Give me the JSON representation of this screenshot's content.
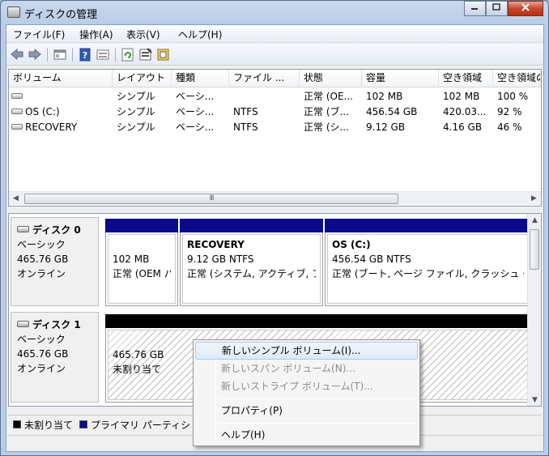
{
  "window": {
    "title": "ディスクの管理",
    "controls": [
      "minimize",
      "maximize",
      "close"
    ]
  },
  "menu": [
    "ファイル(F)",
    "操作(A)",
    "表示(V)",
    "ヘルプ(H)"
  ],
  "toolbar": [
    "back-icon",
    "forward-icon",
    "console-icon",
    "help-icon",
    "view-icon",
    "refresh-icon",
    "properties-icon",
    "rescan-icon"
  ],
  "list": {
    "columns": [
      "ボリューム",
      "レイアウト",
      "種類",
      "ファイル ...",
      "状態",
      "容量",
      "空き領域",
      "空き領域の"
    ],
    "rows": [
      [
        "",
        "シンプル",
        "ベーシ...",
        "",
        "正常 (OE...",
        "102 MB",
        "102 MB",
        "100 %"
      ],
      [
        "OS (C:)",
        "シンプル",
        "ベーシ...",
        "NTFS",
        "正常 (ブ...",
        "456.54 GB",
        "420.03...",
        "92 %"
      ],
      [
        "RECOVERY",
        "シンプル",
        "ベーシ...",
        "NTFS",
        "正常 (シ...",
        "9.12 GB",
        "4.16 GB",
        "46 %"
      ]
    ]
  },
  "scroll_thumb_grip": "III",
  "disks": [
    {
      "name": "ディスク 0",
      "type": "ベーシック",
      "size": "465.76 GB",
      "status": "オンライン",
      "partitions": [
        {
          "name": "",
          "size": "102 MB",
          "desc": "正常 (OEM パ"
        },
        {
          "name": "RECOVERY",
          "size": "9.12 GB NTFS",
          "desc": "正常 (システム, アクティブ, フ"
        },
        {
          "name": "OS  (C:)",
          "size": "456.54 GB NTFS",
          "desc": "正常 (ブート, ページ ファイル, クラッシュ ダ"
        }
      ]
    },
    {
      "name": "ディスク 1",
      "type": "ベーシック",
      "size": "465.76 GB",
      "status": "オンライン",
      "partitions": [
        {
          "size": "465.76 GB",
          "desc": "未割り当て"
        }
      ]
    }
  ],
  "legend": [
    {
      "label": "未割り当て",
      "color": "#000000"
    },
    {
      "label": "プライマリ パーティシ",
      "color": "#0b0b8a"
    }
  ],
  "context_menu": [
    {
      "label": "新しいシンプル ボリューム(I)...",
      "enabled": true,
      "highlighted": true
    },
    {
      "label": "新しいスパン ボリューム(N)...",
      "enabled": false
    },
    {
      "label": "新しいストライプ ボリューム(T)...",
      "enabled": false
    },
    {
      "label": "プロパティ(P)",
      "enabled": true
    },
    {
      "label": "ヘルプ(H)",
      "enabled": true
    }
  ]
}
